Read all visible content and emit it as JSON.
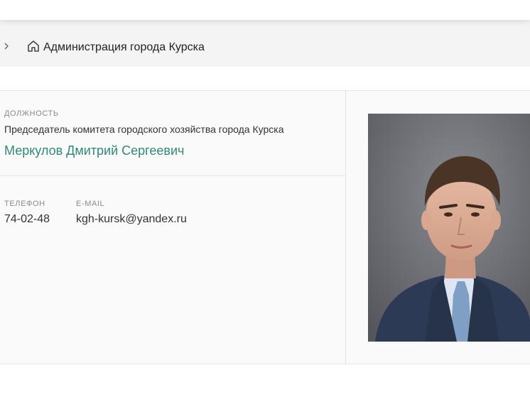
{
  "breadcrumb": {
    "home_icon": "home-icon",
    "chevron_icon": "chevron-right-icon",
    "label": "Администрация города Курска"
  },
  "official": {
    "position_label": "ДОЛЖНОСТЬ",
    "position": "Председатель комитета городского хозяйства города Курска",
    "name": "Меркулов Дмитрий Сергеевич",
    "phone_label": "ТЕЛЕФОН",
    "phone": "74-02-48",
    "email_label": "E-MAIL",
    "email": "kgh-kursk@yandex.ru"
  },
  "colors": {
    "name_accent": "#2f8a78",
    "breadcrumb_bg": "#f4f4f4",
    "card_bg": "#fafafa"
  }
}
